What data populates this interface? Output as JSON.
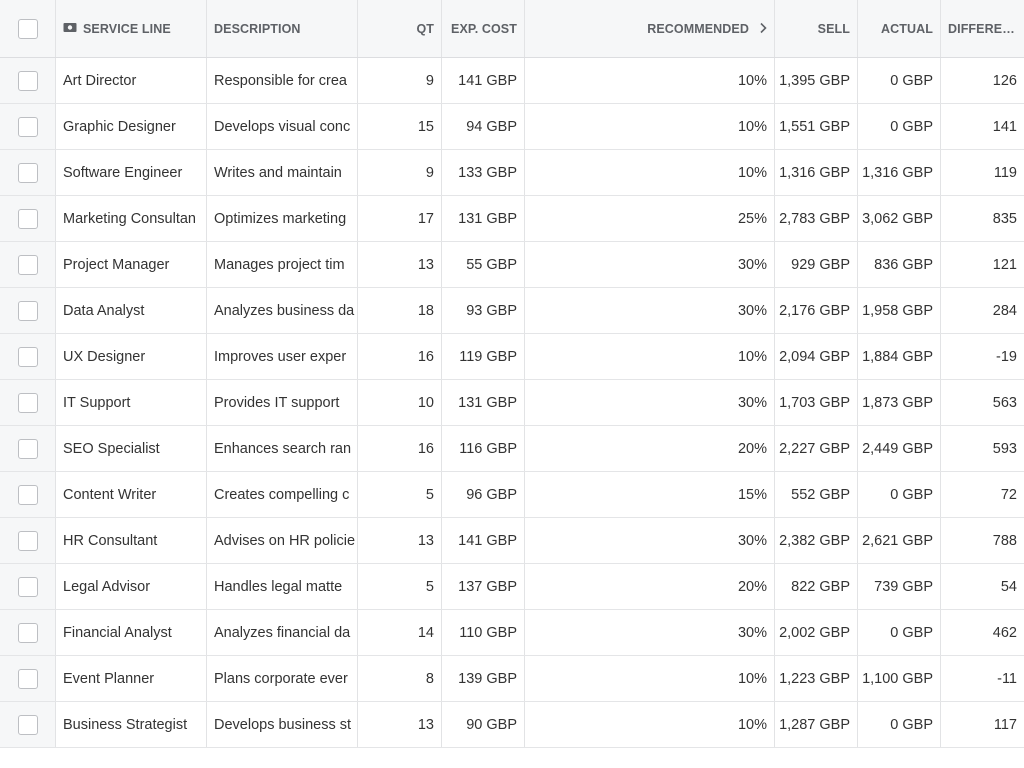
{
  "columns": {
    "service_line": "SERVICE LINE",
    "description": "DESCRIPTION",
    "qt": "QT",
    "exp_cost": "EXP. COST",
    "recommended": "RECOMMENDED",
    "sell": "SELL",
    "actual": "ACTUAL",
    "difference": "DIFFEREN..."
  },
  "icons": {
    "service_line": "money-icon",
    "recommended": "chevron-right-icon"
  },
  "rows": [
    {
      "service": "Art Director",
      "description": "Responsible for crea",
      "qt": "9",
      "exp_cost": "141 GBP",
      "recommended": "10%",
      "sell": "1,395 GBP",
      "actual": "0 GBP",
      "difference": "126"
    },
    {
      "service": "Graphic Designer",
      "description": "Develops visual conc",
      "qt": "15",
      "exp_cost": "94 GBP",
      "recommended": "10%",
      "sell": "1,551 GBP",
      "actual": "0 GBP",
      "difference": "141"
    },
    {
      "service": "Software Engineer",
      "description": "Writes and maintain",
      "qt": "9",
      "exp_cost": "133 GBP",
      "recommended": "10%",
      "sell": "1,316 GBP",
      "actual": "1,316 GBP",
      "difference": "119"
    },
    {
      "service": "Marketing Consultan",
      "description": "Optimizes marketing",
      "qt": "17",
      "exp_cost": "131 GBP",
      "recommended": "25%",
      "sell": "2,783 GBP",
      "actual": "3,062 GBP",
      "difference": "835"
    },
    {
      "service": "Project Manager",
      "description": "Manages project tim",
      "qt": "13",
      "exp_cost": "55 GBP",
      "recommended": "30%",
      "sell": "929 GBP",
      "actual": "836 GBP",
      "difference": "121"
    },
    {
      "service": "Data Analyst",
      "description": "Analyzes business da",
      "qt": "18",
      "exp_cost": "93 GBP",
      "recommended": "30%",
      "sell": "2,176 GBP",
      "actual": "1,958 GBP",
      "difference": "284"
    },
    {
      "service": "UX Designer",
      "description": "Improves user exper",
      "qt": "16",
      "exp_cost": "119 GBP",
      "recommended": "10%",
      "sell": "2,094 GBP",
      "actual": "1,884 GBP",
      "difference": "-19"
    },
    {
      "service": "IT Support",
      "description": "Provides IT support",
      "qt": "10",
      "exp_cost": "131 GBP",
      "recommended": "30%",
      "sell": "1,703 GBP",
      "actual": "1,873 GBP",
      "difference": "563"
    },
    {
      "service": "SEO Specialist",
      "description": "Enhances search ran",
      "qt": "16",
      "exp_cost": "116 GBP",
      "recommended": "20%",
      "sell": "2,227 GBP",
      "actual": "2,449 GBP",
      "difference": "593"
    },
    {
      "service": "Content Writer",
      "description": "Creates compelling c",
      "qt": "5",
      "exp_cost": "96 GBP",
      "recommended": "15%",
      "sell": "552 GBP",
      "actual": "0 GBP",
      "difference": "72"
    },
    {
      "service": "HR Consultant",
      "description": "Advises on HR policie",
      "qt": "13",
      "exp_cost": "141 GBP",
      "recommended": "30%",
      "sell": "2,382 GBP",
      "actual": "2,621 GBP",
      "difference": "788"
    },
    {
      "service": "Legal Advisor",
      "description": "Handles legal matte",
      "qt": "5",
      "exp_cost": "137 GBP",
      "recommended": "20%",
      "sell": "822 GBP",
      "actual": "739 GBP",
      "difference": "54"
    },
    {
      "service": "Financial Analyst",
      "description": "Analyzes financial da",
      "qt": "14",
      "exp_cost": "110 GBP",
      "recommended": "30%",
      "sell": "2,002 GBP",
      "actual": "0 GBP",
      "difference": "462"
    },
    {
      "service": "Event Planner",
      "description": "Plans corporate ever",
      "qt": "8",
      "exp_cost": "139 GBP",
      "recommended": "10%",
      "sell": "1,223 GBP",
      "actual": "1,100 GBP",
      "difference": "-11"
    },
    {
      "service": "Business Strategist",
      "description": "Develops business st",
      "qt": "13",
      "exp_cost": "90 GBP",
      "recommended": "10%",
      "sell": "1,287 GBP",
      "actual": "0 GBP",
      "difference": "117"
    }
  ]
}
